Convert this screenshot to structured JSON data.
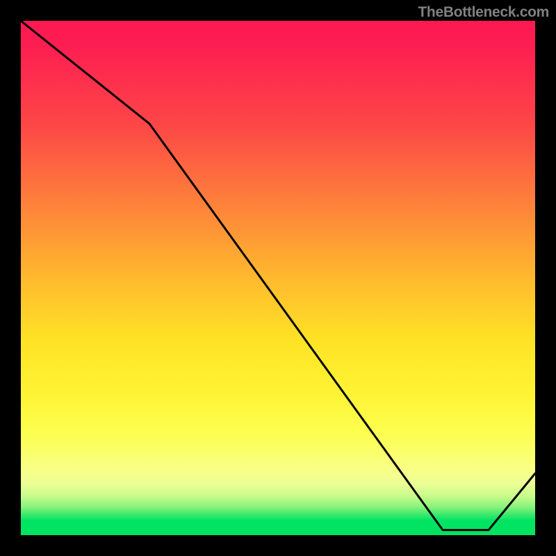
{
  "watermark": "TheBottleneck.com",
  "annotation_label": "",
  "chart_data": {
    "type": "line",
    "title": "",
    "xlabel": "",
    "ylabel": "",
    "xlim": [
      0,
      100
    ],
    "ylim": [
      0,
      100
    ],
    "series": [
      {
        "name": "curve",
        "x": [
          0,
          25,
          82,
          91,
          100
        ],
        "values": [
          100,
          80,
          1,
          1,
          12
        ]
      }
    ],
    "annotations": [
      {
        "x": 86,
        "y": 2,
        "text": ""
      }
    ],
    "background": "heat-gradient-vertical",
    "description": "bottleneck-style chart: vertical red→green gradient background, single black V-curve dipping to near-zero around x≈82–91 then rising"
  }
}
